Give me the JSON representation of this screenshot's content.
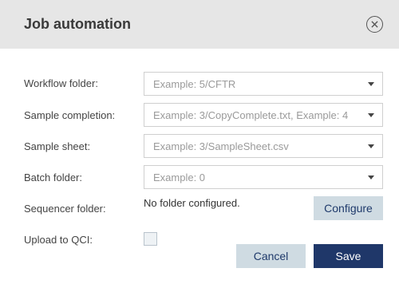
{
  "dialog": {
    "title": "Job automation",
    "close_icon": "close-circle-icon"
  },
  "fields": {
    "workflow_folder": {
      "label": "Workflow folder:",
      "placeholder": "Example: 5/CFTR"
    },
    "sample_completion": {
      "label": "Sample completion:",
      "placeholder": "Example: 3/CopyComplete.txt, Example: 4"
    },
    "sample_sheet": {
      "label": "Sample sheet:",
      "placeholder": "Example: 3/SampleSheet.csv"
    },
    "batch_folder": {
      "label": "Batch folder:",
      "placeholder": "Example: 0"
    },
    "sequencer_folder": {
      "label": "Sequencer folder:",
      "status": "No folder configured.",
      "configure_label": "Configure"
    },
    "upload_qci": {
      "label": "Upload to QCI:",
      "checked": false
    }
  },
  "actions": {
    "cancel_label": "Cancel",
    "save_label": "Save"
  },
  "colors": {
    "header_bg": "#e6e6e6",
    "primary": "#1f3769",
    "secondary": "#cfdbe2"
  }
}
